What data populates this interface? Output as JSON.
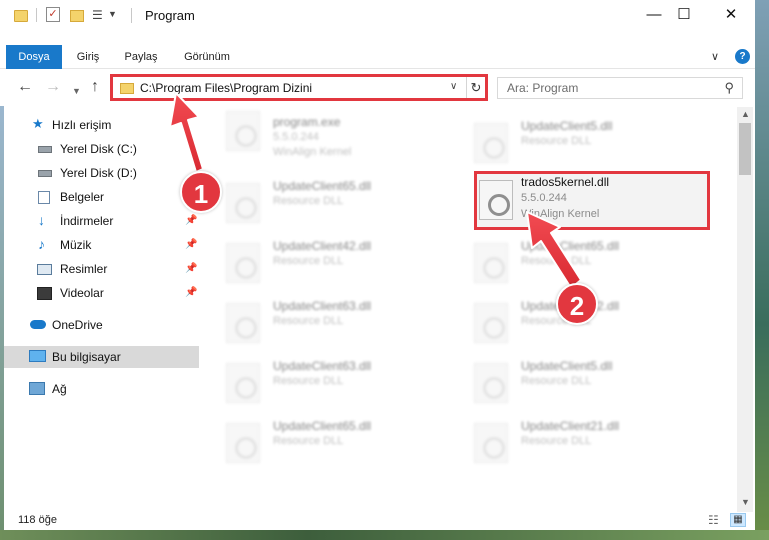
{
  "window": {
    "title": "Program",
    "min_glyph": "—",
    "max_glyph": "☐",
    "close_glyph": "✕"
  },
  "ribbon": {
    "tabs": [
      "Dosya",
      "Giriş",
      "Paylaş",
      "Görünüm"
    ],
    "help_glyph": "?",
    "expand_glyph": "∨"
  },
  "address": {
    "path": "C:\\Program Files\\Program Dizini",
    "search_placeholder": "Ara: Program"
  },
  "sidebar": {
    "items": [
      {
        "label": "Hızlı erişim",
        "icon": "star-icon",
        "pinned": false
      },
      {
        "label": "Yerel Disk (C:)",
        "icon": "drive-icon",
        "pinned": false
      },
      {
        "label": "Yerel Disk (D:)",
        "icon": "drive-icon",
        "pinned": false
      },
      {
        "label": "Belgeler",
        "icon": "documents-icon",
        "pinned": true
      },
      {
        "label": "İndirmeler",
        "icon": "download-icon",
        "pinned": true
      },
      {
        "label": "Müzik",
        "icon": "music-icon",
        "pinned": true
      },
      {
        "label": "Resimler",
        "icon": "pictures-icon",
        "pinned": true
      },
      {
        "label": "Videolar",
        "icon": "videos-icon",
        "pinned": true
      },
      {
        "label": "OneDrive",
        "icon": "cloud-icon",
        "pinned": false
      },
      {
        "label": "Bu bilgisayar",
        "icon": "computer-icon",
        "pinned": false
      },
      {
        "label": "Ağ",
        "icon": "network-icon",
        "pinned": false
      }
    ]
  },
  "files": [
    {
      "name": "program.exe",
      "line2": "5.5.0.244",
      "line3": "WinAlign Kernel"
    },
    {
      "name": "UpdateClient5.dll",
      "line2": "Resource DLL",
      "line3": ""
    },
    {
      "name": "UpdateClient65.dll",
      "line2": "Resource DLL",
      "line3": ""
    },
    {
      "name": "trados5kernel.dll",
      "line2": "5.5.0.244",
      "line3": "WinAlign Kernel"
    },
    {
      "name": "UpdateClient42.dll",
      "line2": "Resource DLL",
      "line3": ""
    },
    {
      "name": "UpdateClient65.dll",
      "line2": "Resource DLL",
      "line3": ""
    },
    {
      "name": "UpdateClient63.dll",
      "line2": "Resource DLL",
      "line3": ""
    },
    {
      "name": "UpdateClient42.dll",
      "line2": "Resource DLL",
      "line3": ""
    },
    {
      "name": "UpdateClient63.dll",
      "line2": "Resource DLL",
      "line3": ""
    },
    {
      "name": "UpdateClient5.dll",
      "line2": "Resource DLL",
      "line3": ""
    },
    {
      "name": "UpdateClient65.dll",
      "line2": "Resource DLL",
      "line3": ""
    },
    {
      "name": "UpdateClient21.dll",
      "line2": "Resource DLL",
      "line3": ""
    }
  ],
  "status": {
    "item_count": "118 öğe"
  },
  "annotations": {
    "badge1": "1",
    "badge2": "2",
    "color": "#e2373f"
  },
  "colors": {
    "accent": "#1979ca",
    "highlight": "#e2373f"
  }
}
